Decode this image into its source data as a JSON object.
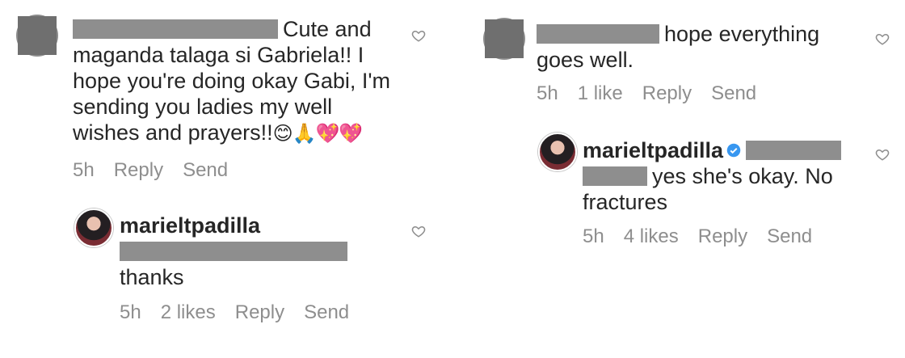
{
  "left": {
    "comment": {
      "text_line1": "Cute and",
      "text_rest": "maganda talaga si Gabriela!! I hope you're doing okay Gabi, I'm sending you ladies my well wishes and prayers!!",
      "emojis": "😊🙏💖💖",
      "time": "5h",
      "reply": "Reply",
      "send": "Send"
    },
    "reply": {
      "username": "marieltpadilla",
      "text": "thanks",
      "time": "5h",
      "likes": "2 likes",
      "reply": "Reply",
      "send": "Send"
    }
  },
  "right": {
    "comment": {
      "text_line1": "hope everything",
      "text_line2": "goes well.",
      "time": "5h",
      "likes": "1 like",
      "reply": "Reply",
      "send": "Send"
    },
    "reply": {
      "username": "marieltpadilla",
      "text_line2": "yes she's okay. No",
      "text_line3": "fractures",
      "time": "5h",
      "likes": "4 likes",
      "reply": "Reply",
      "send": "Send"
    }
  },
  "icons": {
    "heart": "heart-outline-icon",
    "verified": "verified-badge-icon"
  },
  "colors": {
    "text": "#262626",
    "meta": "#8e8e8e",
    "verified": "#3897f0",
    "redaction": "#8e8e8e"
  }
}
